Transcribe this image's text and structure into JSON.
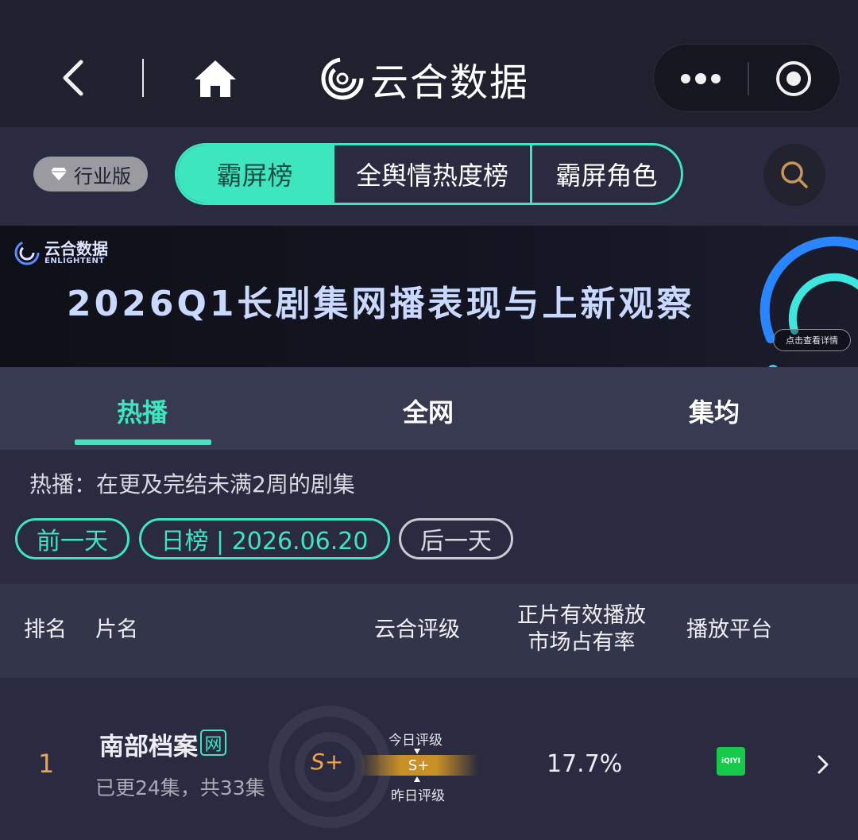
{
  "nav": {
    "brand": "云合数据"
  },
  "toolbar": {
    "industry_label": "行业版",
    "segments": [
      "霸屏榜",
      "全舆情热度榜",
      "霸屏角色"
    ],
    "active_segment": "霸屏榜"
  },
  "banner": {
    "logo_cn": "云合数据",
    "logo_en": "ENLIGHTENT",
    "title": "2026Q1长剧集网播表现与上新观察",
    "detail_button": "点击查看详情"
  },
  "subtabs": [
    "热播",
    "全网",
    "集均"
  ],
  "active_subtab": "热播",
  "description": "热播：在更及完结未满2周的剧集",
  "date_nav": {
    "prev": "前一天",
    "current": "日榜 | 2026.06.20",
    "next": "后一天"
  },
  "table": {
    "headers": {
      "rank": "排名",
      "title": "片名",
      "rating": "云合评级",
      "share_line1": "正片有效播放",
      "share_line2": "市场占有率",
      "platform": "播放平台"
    },
    "rows": [
      {
        "rank": "1",
        "title": "南部档案",
        "badge": "网",
        "episodes": "已更24集，共33集",
        "grade": "S+",
        "today_label": "今日评级",
        "yesterday_label": "昨日评级",
        "bar_grade": "S+",
        "share": "17.7%",
        "platform": "iQIYI",
        "platform_color": "#17c94a"
      }
    ]
  },
  "colors": {
    "accent": "#3ee6c0",
    "rank": "#f0a34a",
    "background": "#2a2b40"
  }
}
